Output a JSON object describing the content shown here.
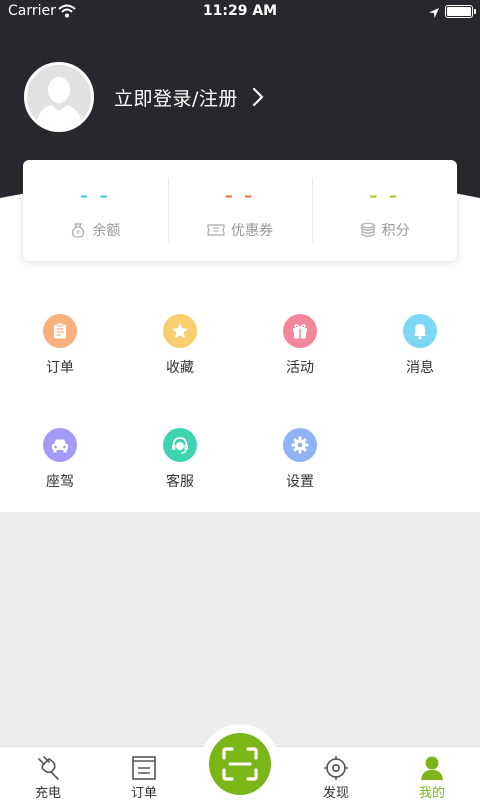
{
  "status_bar": {
    "carrier": "Carrier",
    "time": "11:29 AM"
  },
  "profile": {
    "login_text": "立即登录/注册"
  },
  "stats": [
    {
      "value": "– –",
      "label": "余额",
      "color": "#3cc6d6",
      "icon": "money-bag-icon"
    },
    {
      "value": "– –",
      "label": "优惠券",
      "color": "#f06a3c",
      "icon": "coupon-icon"
    },
    {
      "value": "– –",
      "label": "积分",
      "color": "#a6c52a",
      "icon": "coins-icon"
    }
  ],
  "grid": [
    {
      "label": "订单",
      "color": "#f8b07f",
      "icon": "clipboard-icon"
    },
    {
      "label": "收藏",
      "color": "#f7cf6e",
      "icon": "star-icon"
    },
    {
      "label": "活动",
      "color": "#f2869a",
      "icon": "gift-icon"
    },
    {
      "label": "消息",
      "color": "#7dd6f4",
      "icon": "bell-icon"
    },
    {
      "label": "座驾",
      "color": "#a59af5",
      "icon": "car-icon"
    },
    {
      "label": "客服",
      "color": "#3dd4b2",
      "icon": "headset-icon"
    },
    {
      "label": "设置",
      "color": "#8fb3f5",
      "icon": "gear-icon"
    }
  ],
  "tabs": [
    {
      "label": "充电",
      "icon": "plug-icon",
      "active": false
    },
    {
      "label": "订单",
      "icon": "order-list-icon",
      "active": false
    },
    {
      "label": "发现",
      "icon": "target-icon",
      "active": false
    },
    {
      "label": "我的",
      "icon": "person-icon",
      "active": true
    }
  ],
  "colors": {
    "header": "#28272c",
    "accent": "#7cb518",
    "page_bg": "#ededed"
  }
}
